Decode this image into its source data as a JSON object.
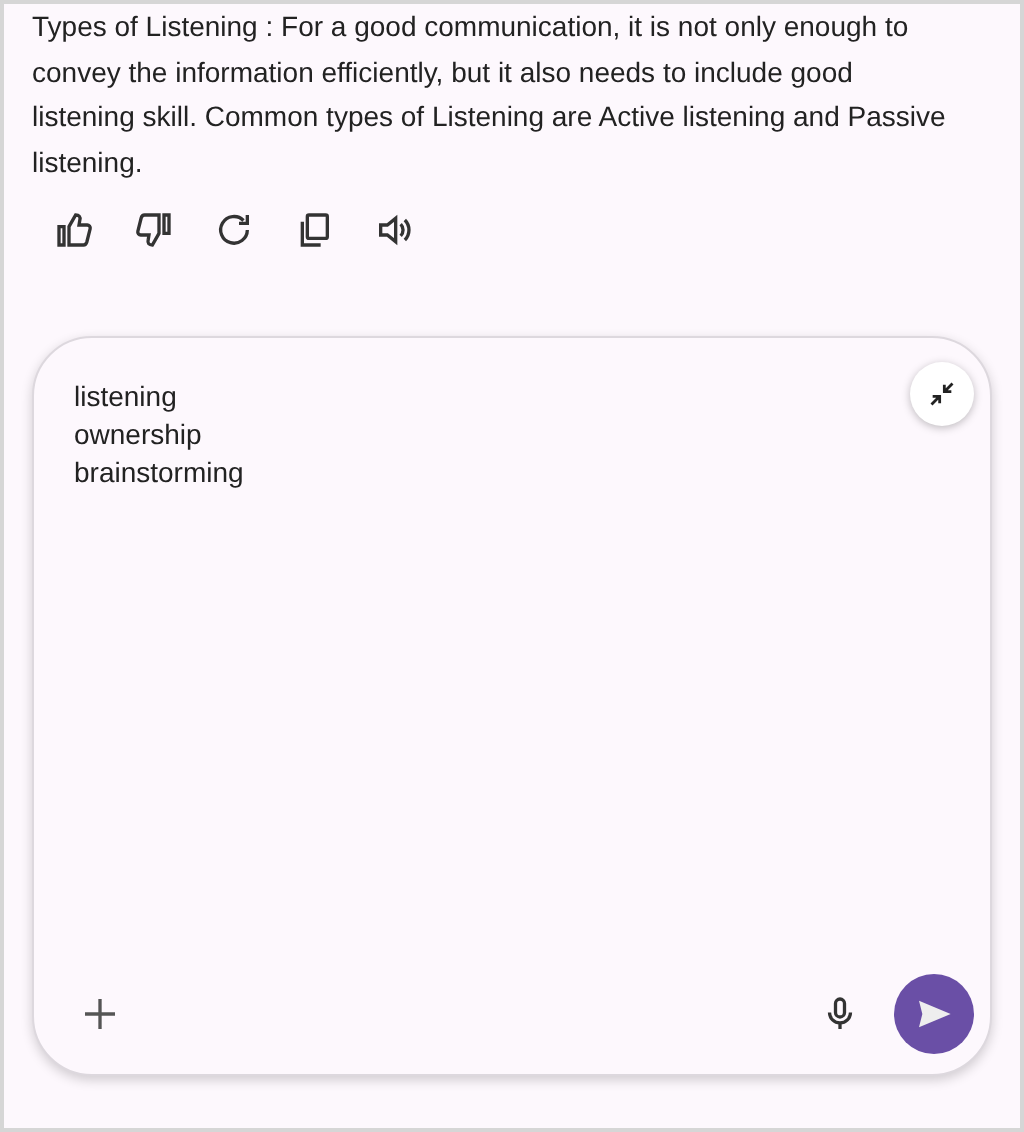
{
  "message": {
    "lines": [
      "Types of Listening : For a good communication, it is not only enough to",
      "convey the information efficiently, but it also needs to include good",
      "listening skill. Common types of Listening are Active listening and Passive",
      "listening."
    ]
  },
  "composer": {
    "value": "listening\nownership\nbrainstorming"
  }
}
